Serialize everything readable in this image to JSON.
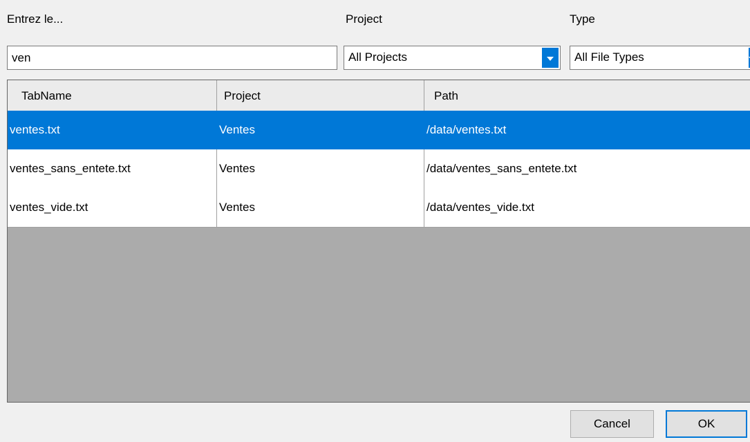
{
  "filters": {
    "search_label": "Entrez le...",
    "search_value": "ven",
    "project_label": "Project",
    "project_selected": "All Projects",
    "type_label": "Type",
    "type_selected": "All File Types"
  },
  "grid": {
    "columns": [
      "TabName",
      "Project",
      "Path"
    ],
    "rows": [
      {
        "tabname": "ventes.txt",
        "project": "Ventes",
        "path": "/data/ventes.txt",
        "selected": true
      },
      {
        "tabname": "ventes_sans_entete.txt",
        "project": "Ventes",
        "path": "/data/ventes_sans_entete.txt",
        "selected": false
      },
      {
        "tabname": "ventes_vide.txt",
        "project": "Ventes",
        "path": "/data/ventes_vide.txt",
        "selected": false
      }
    ]
  },
  "buttons": {
    "cancel": "Cancel",
    "ok": "OK"
  },
  "colors": {
    "accent": "#0078d7",
    "grid_background": "#ababab",
    "window_background": "#f0f0f0"
  }
}
